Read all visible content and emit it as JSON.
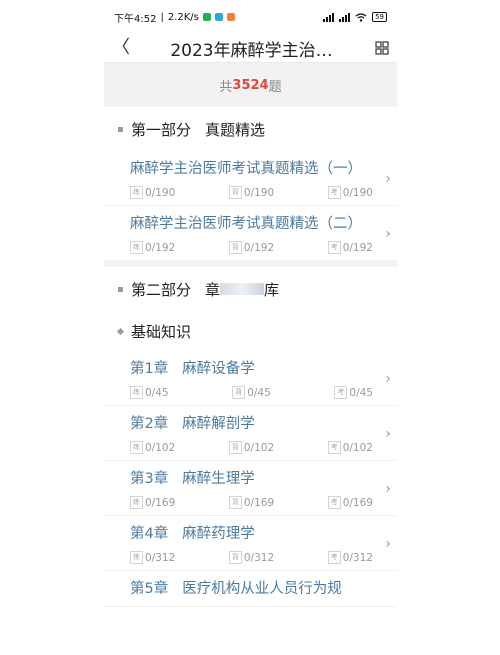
{
  "status_bar": {
    "time": "下午4:52",
    "speed": "2.2K/s",
    "battery": "59"
  },
  "header": {
    "back_label": "〈",
    "title": "2023年麻醉学主治…"
  },
  "summary": {
    "prefix": "共",
    "count": "3524",
    "suffix": "题"
  },
  "part1": {
    "label": "第一部分",
    "name": "真题精选",
    "items": [
      {
        "title": "麻醉学主治医师考试真题精选（一）",
        "practice": "0/190",
        "recite": "0/190",
        "exam": "0/190"
      },
      {
        "title": "麻醉学主治医师考试真题精选（二）",
        "practice": "0/192",
        "recite": "0/192",
        "exam": "0/192"
      }
    ]
  },
  "part2": {
    "label": "第二部分",
    "name_start": "章",
    "name_end": "库",
    "subsection": "基础知识",
    "chapters": [
      {
        "num": "第1章",
        "name": "麻醉设备学",
        "practice": "0/45",
        "recite": "0/45",
        "exam": "0/45"
      },
      {
        "num": "第2章",
        "name": "麻醉解剖学",
        "practice": "0/102",
        "recite": "0/102",
        "exam": "0/102"
      },
      {
        "num": "第3章",
        "name": "麻醉生理学",
        "practice": "0/169",
        "recite": "0/169",
        "exam": "0/169"
      },
      {
        "num": "第4章",
        "name": "麻醉药理学",
        "practice": "0/312",
        "recite": "0/312",
        "exam": "0/312"
      },
      {
        "num": "第5章",
        "name": "医疗机构从业人员行为规"
      }
    ]
  },
  "tags": {
    "practice": "练",
    "recite": "背",
    "exam": "考"
  },
  "colors": {
    "accent_red": "#e4453a",
    "link_blue": "#4c7aa0"
  }
}
